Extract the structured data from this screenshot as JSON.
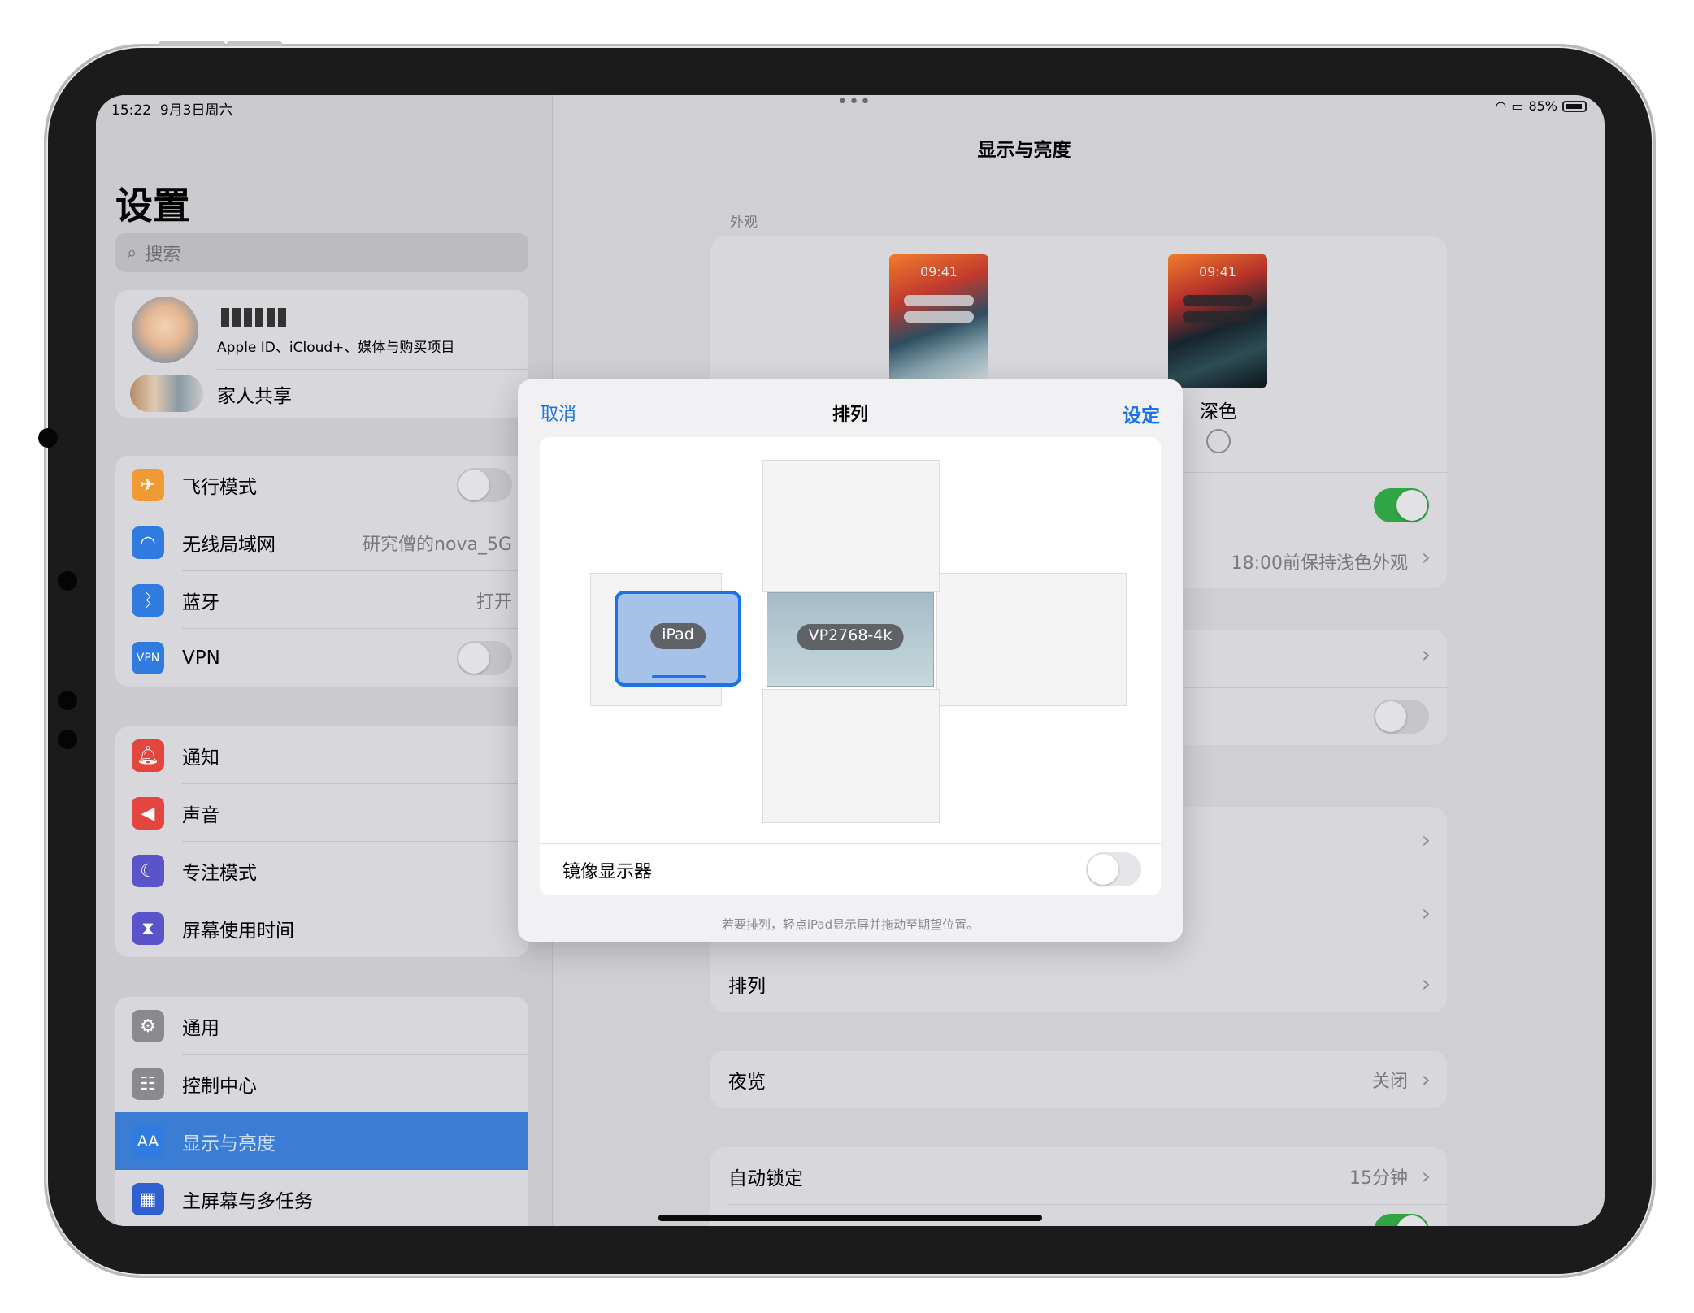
{
  "status": {
    "time": "15:22",
    "date": "9月3日周六",
    "battery": "85%"
  },
  "sidebar": {
    "title": "设置",
    "search_placeholder": "搜索",
    "profile": {
      "subtitle": "Apple ID、iCloud+、媒体与购买项目",
      "family": "家人共享"
    },
    "network": [
      {
        "label": "飞行模式",
        "icon": "airplane-icon",
        "color": "#f09a36"
      },
      {
        "label": "无线局域网",
        "value": "研究僧的nova_5G",
        "icon": "wifi-icon",
        "color": "#2f7be0"
      },
      {
        "label": "蓝牙",
        "value": "打开",
        "icon": "bluetooth-icon",
        "color": "#2f7be0"
      },
      {
        "label": "VPN",
        "icon": "vpn-icon",
        "color": "#2f7be0"
      }
    ],
    "alerts": [
      {
        "label": "通知",
        "icon": "bell-icon",
        "color": "#e3463e"
      },
      {
        "label": "声音",
        "icon": "speaker-icon",
        "color": "#e3463e"
      },
      {
        "label": "专注模式",
        "icon": "moon-icon",
        "color": "#5b53c9"
      },
      {
        "label": "屏幕使用时间",
        "icon": "hourglass-icon",
        "color": "#5b53c9"
      }
    ],
    "general": [
      {
        "label": "通用",
        "icon": "gear-icon",
        "color": "#8a8a8e"
      },
      {
        "label": "控制中心",
        "icon": "switches-icon",
        "color": "#8a8a8e"
      },
      {
        "label": "显示与亮度",
        "icon": "text-size-icon",
        "color": "#2f7be0"
      },
      {
        "label": "主屏幕与多任务",
        "icon": "grid-icon",
        "color": "#2f5fd0"
      }
    ]
  },
  "main": {
    "title": "显示与亮度",
    "appearance_header": "外观",
    "light_time": "09:41",
    "dark_time": "09:41",
    "dark_label": "深色",
    "auto_value": "18:00前保持浅色外观",
    "arrange_label": "排列",
    "night_shift_label": "夜览",
    "night_shift_value": "关闭",
    "autolock_label": "自动锁定",
    "autolock_value": "15分钟"
  },
  "dialog": {
    "cancel": "取消",
    "title": "排列",
    "done": "设定",
    "ipad_label": "iPad",
    "external_label": "VP2768-4k",
    "mirror_label": "镜像显示器",
    "footer": "若要排列，轻点iPad显示屏并拖动至期望位置。"
  }
}
